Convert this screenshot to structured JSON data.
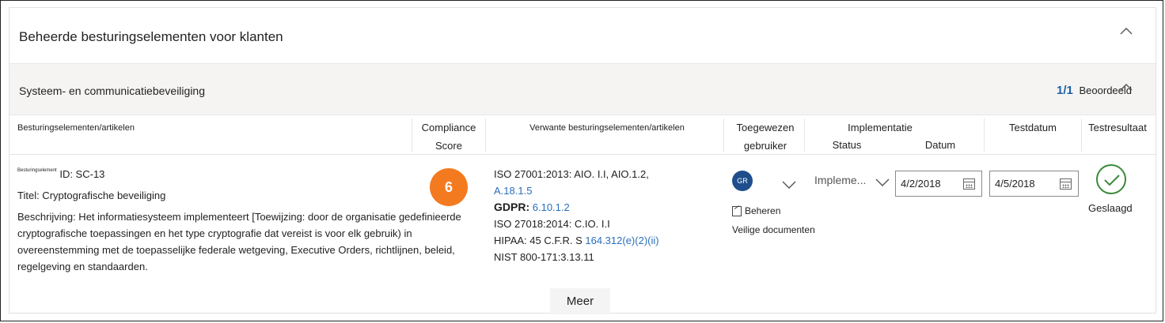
{
  "section": {
    "title": "Beheerde besturingselementen voor klanten"
  },
  "group": {
    "title": "Systeem- en communicatiebeveiliging",
    "assessed_fraction": "1/1",
    "assessed_label": "Beoordeeld"
  },
  "columns": {
    "controls": "Besturingselementen/artikelen",
    "compliance": "Compliance",
    "score": "Score",
    "related": "Verwante besturingselementen/artikelen",
    "assigned_1": "Toegewezen",
    "assigned_2": "gebruiker",
    "implementation": "Implementatie",
    "status": "Status",
    "date": "Datum",
    "test_date": "Testdatum",
    "test_result": "Testresultaat"
  },
  "control": {
    "tiny_label": "Besturingselement",
    "id": "ID: SC-13",
    "title": "Titel: Cryptografische beveiliging",
    "description": "Beschrijving: Het informatiesysteem implementeert [Toewijzing: door de organisatie gedefinieerde cryptografische toepassingen en het type cryptografie dat vereist is voor elk gebruik) in overeenstemming met de toepasselijke federale wetgeving, Executive Orders, richtlijnen, beleid, regelgeving en standaarden.",
    "score": "6",
    "related": {
      "iso27001_text": "ISO 27001:2013: AIO. I.I, AIO.1.2,",
      "iso27001_link": "A.18.1.5",
      "gdpr_label": "GDPR:",
      "gdpr_link": "6.10.1.2",
      "iso27018": "ISO 27018:2014: C.IO. I.I",
      "hipaa_text": "HIPAA: 45 C.F.R. S",
      "hipaa_link": "164.312(e)(2)(ii)",
      "nist": "NIST 800-171:3.13.11"
    },
    "assignee_initials": "GR",
    "manage_label": "Beheren",
    "secure_docs": "Veilige documenten",
    "impl_status": "Impleme...",
    "impl_date": "4/2/2018",
    "test_date": "4/5/2018",
    "test_result": "Geslaagd"
  },
  "more_label": "Meer"
}
